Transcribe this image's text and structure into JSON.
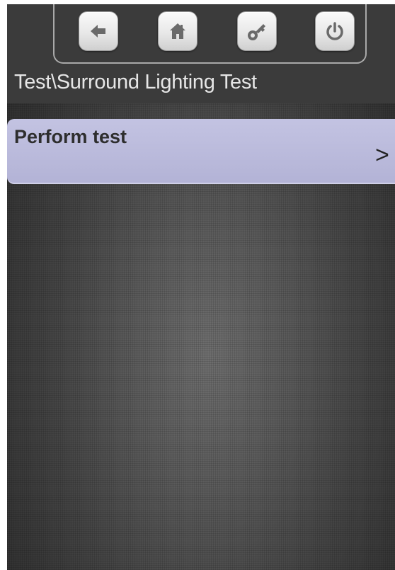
{
  "toolbar": {
    "buttons": [
      {
        "name": "back",
        "icon": "arrow-left-icon"
      },
      {
        "name": "home",
        "icon": "house-icon"
      },
      {
        "name": "login",
        "icon": "key-icon"
      },
      {
        "name": "power",
        "icon": "power-icon"
      }
    ]
  },
  "header": {
    "breadcrumb": "Test\\Surround Lighting Test"
  },
  "menu": {
    "items": [
      {
        "label": "Perform test",
        "chevron": ">"
      }
    ]
  },
  "colors": {
    "background_dark": "#3b3b3b",
    "menu_item_bg": "#b8b8da",
    "icon_gray": "#6a6a6a",
    "text_light": "#e6e6e6"
  }
}
